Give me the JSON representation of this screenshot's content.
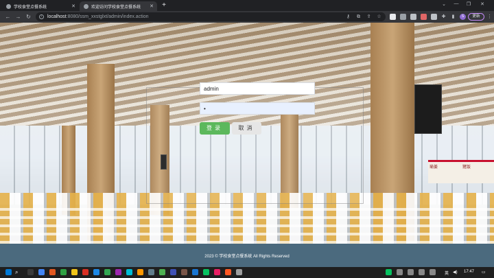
{
  "browser": {
    "tabs": [
      {
        "label": "学校食堂点餐系统",
        "active": false
      },
      {
        "label": "欢迎访问学校食堂点餐系统",
        "active": true
      }
    ],
    "new_tab": "+",
    "url_host": "localhost",
    "url_rest": ":8080/ssm_xxstglxt/admin/index.action",
    "update_label": "更新",
    "profile_initial": "S",
    "icons": {
      "back": "arrow-left-icon",
      "forward": "arrow-right-icon",
      "reload": "reload-icon",
      "info": "info-icon",
      "key": "key-icon",
      "share": "share-icon",
      "star": "star-icon",
      "extensions": "puzzle-icon"
    }
  },
  "login": {
    "username_value": "admin",
    "password_value": "•",
    "login_label": "登录",
    "cancel_label": "取消",
    "login_color": "#5cb85c"
  },
  "menuboard": {
    "items": [
      "瑜姜",
      "猪饭"
    ]
  },
  "footer": {
    "text": "2023 © 学校食堂点餐系统 All Rights Reserved",
    "background": "#4b6a7e"
  },
  "taskbar": {
    "tray_lang": "英",
    "time": "17:47"
  }
}
